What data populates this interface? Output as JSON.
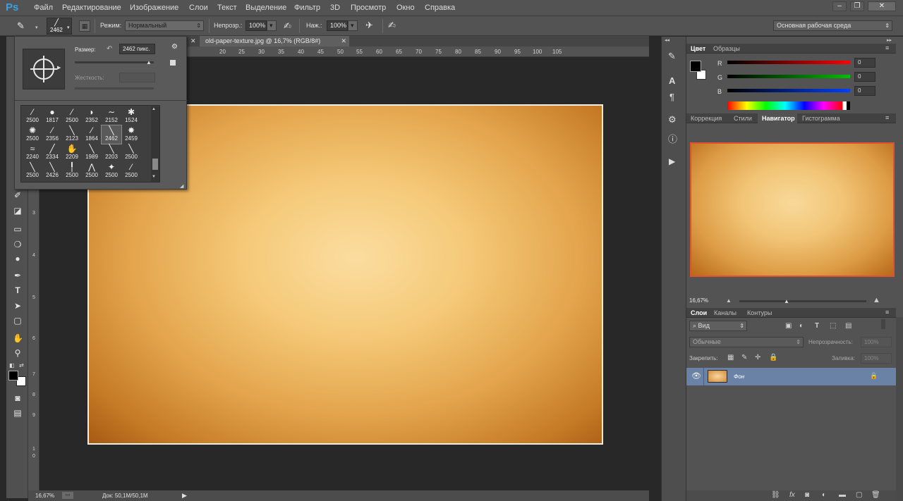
{
  "app": {
    "logo": "Ps"
  },
  "menu": [
    "Файл",
    "Редактирование",
    "Изображение",
    "Слои",
    "Текст",
    "Выделение",
    "Фильтр",
    "3D",
    "Просмотр",
    "Окно",
    "Справка"
  ],
  "window_controls": {
    "minimize": "–",
    "restore": "❐",
    "close": "✕"
  },
  "options": {
    "brush_size": "2462",
    "mode_label": "Режим:",
    "mode_value": "Нормальный",
    "opacity_label": "Непрозр.:",
    "opacity_value": "100%",
    "flow_label": "Наж.:",
    "flow_value": "100%",
    "workspace": "Основная рабочая среда"
  },
  "document": {
    "tab_title": "old-paper-texture.jpg @ 16,7% (RGB/8#)"
  },
  "ruler": {
    "h_ticks": [
      "20",
      "25",
      "30",
      "35",
      "40",
      "45",
      "50",
      "55",
      "60",
      "65",
      "70",
      "75",
      "80",
      "85",
      "90",
      "95",
      "100",
      "105"
    ],
    "v_ticks": [
      "3",
      "4",
      "5",
      "6",
      "7",
      "8",
      "9",
      "1",
      "0"
    ]
  },
  "brush_panel": {
    "size_label": "Размер:",
    "size_value": "2462 пикс.",
    "hardness_label": "Жесткость:",
    "presets": [
      [
        "2500",
        "1817",
        "2500",
        "2352",
        "2152",
        "1524"
      ],
      [
        "2500",
        "2356",
        "2123",
        "1864",
        "2462",
        "2459"
      ],
      [
        "2240",
        "2334",
        "2209",
        "1989",
        "2203",
        "2500"
      ],
      [
        "2500",
        "2426",
        "2500",
        "2500",
        "2500",
        "2500"
      ]
    ]
  },
  "color_panel": {
    "tabs": [
      "Цвет",
      "Образцы"
    ],
    "channels": [
      {
        "label": "R",
        "value": "0",
        "color": "#ff0000"
      },
      {
        "label": "G",
        "value": "0",
        "color": "#00c000"
      },
      {
        "label": "B",
        "value": "0",
        "color": "#0040ff"
      }
    ]
  },
  "navigator_panel": {
    "tabs": [
      "Коррекция",
      "Стили",
      "Навигатор",
      "Гистограмма"
    ],
    "zoom": "16,67%"
  },
  "layers_panel": {
    "tabs": [
      "Слои",
      "Каналы",
      "Контуры"
    ],
    "filter_label": "Вид",
    "blend_mode": "Обычные",
    "opacity_label": "Непрозрачность:",
    "opacity_value": "100%",
    "lock_label": "Закрепить:",
    "fill_label": "Заливка:",
    "fill_value": "100%",
    "layers": [
      {
        "name": "Фон"
      }
    ]
  },
  "status": {
    "zoom": "16,67%",
    "doc_info": "Док: 50,1M/50,1M"
  },
  "colors": {
    "accent": "#e0512d",
    "selected_layer": "#6a82a5"
  }
}
